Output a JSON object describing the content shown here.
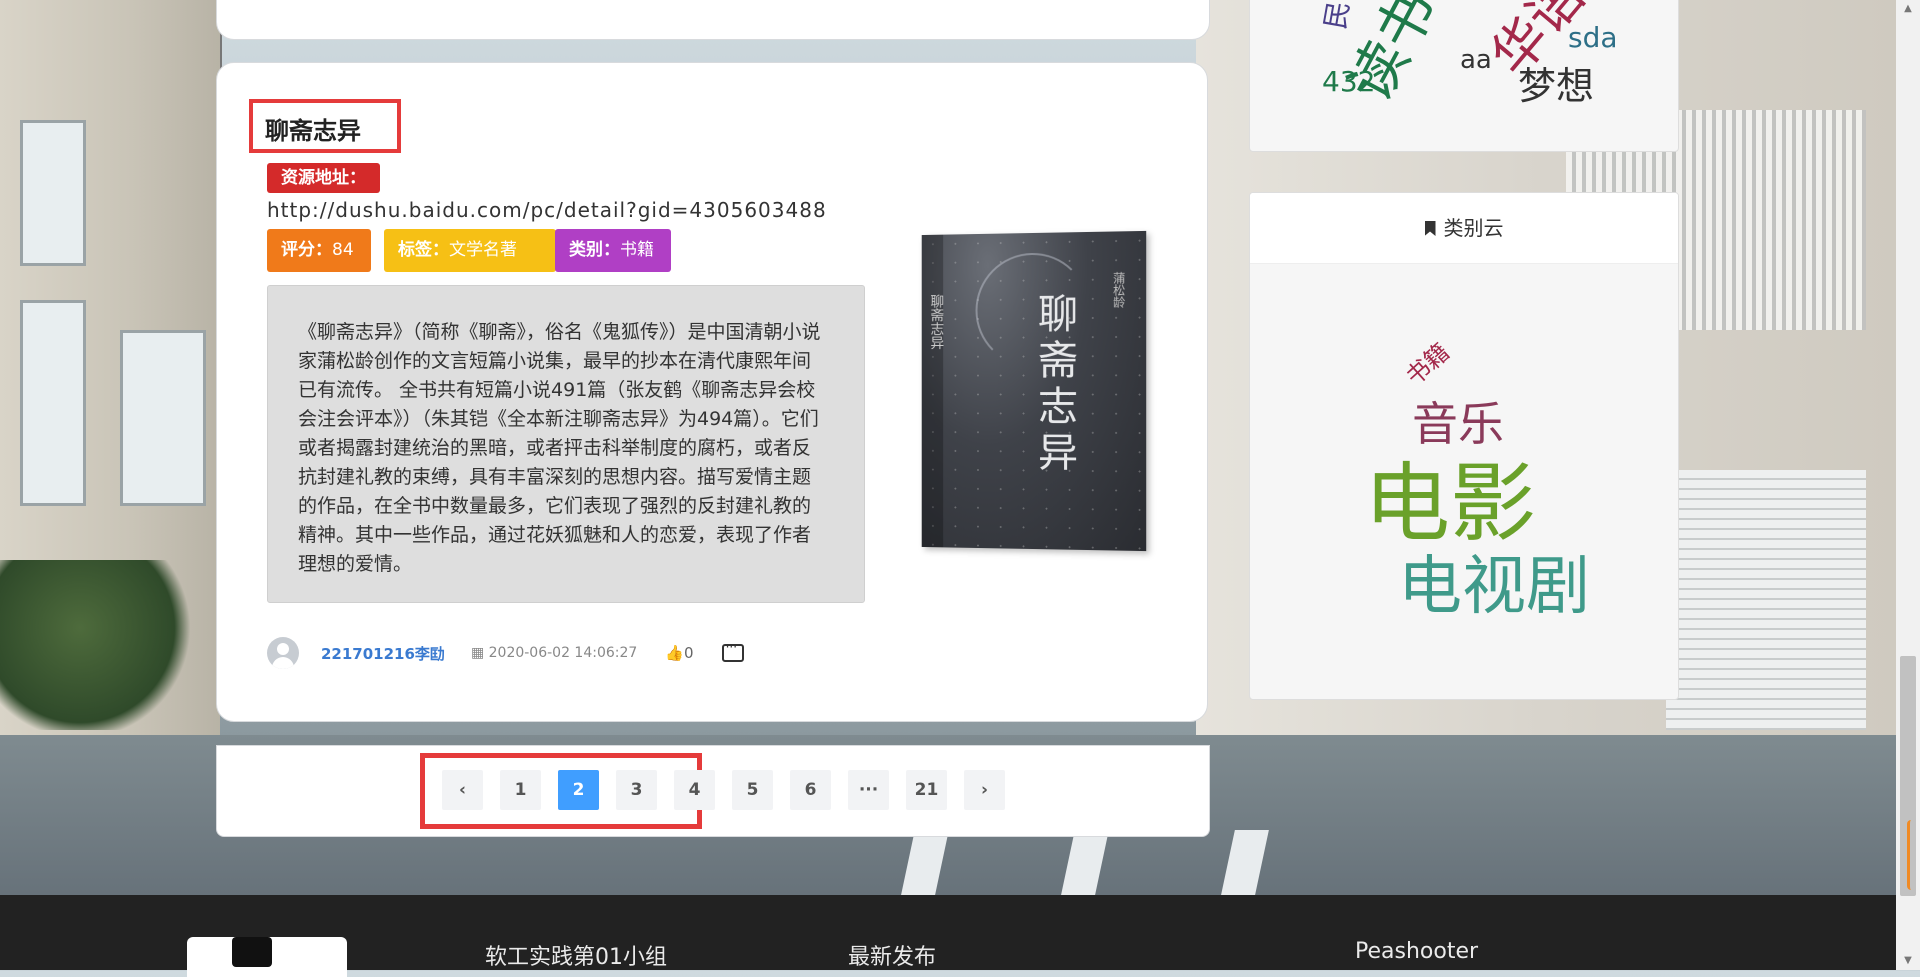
{
  "article": {
    "title": "聊斋志异",
    "resource_label": "资源地址：",
    "url": "http://dushu.baidu.com/pc/detail?gid=4305603488",
    "score_label": "评分：",
    "score_value": "84",
    "tag_label": "标签：",
    "tag_value": "文学名著",
    "category_label": "类别：",
    "category_value": "书籍",
    "description": "《聊斋志异》（简称《聊斋》，俗名《鬼狐传》）是中国清朝小说家蒲松龄创作的文言短篇小说集，最早的抄本在清代康熙年间已有流传。 全书共有短篇小说491篇（张友鹤《聊斋志异会校会注会评本》）（朱其铠《全本新注聊斋志异》为494篇）。它们或者揭露封建统治的黑暗，或者抨击科举制度的腐朽，或者反抗封建礼教的束缚，具有丰富深刻的思想内容。描写爱情主题的作品，在全书中数量最多，它们表现了强烈的反封建礼教的精神。其中一些作品，通过花妖狐魅和人的恋爱，表现了作者理想的爱情。",
    "cover_title": "聊斋志异",
    "cover_author": "蒲松龄",
    "author": "221701216李劻",
    "date": "2020-06-02 14:06:27",
    "likes": "0"
  },
  "pagination": {
    "prev": "‹",
    "next": "›",
    "pages": [
      "1",
      "2",
      "3",
      "4",
      "5",
      "6",
      "···",
      "21"
    ],
    "active": "2"
  },
  "sidebar": {
    "tag_cloud_words": [
      {
        "text": "读书",
        "color": "#1f7a4a"
      },
      {
        "text": "华语",
        "color": "#a3284a"
      },
      {
        "text": "sda",
        "color": "#2d6f87"
      },
      {
        "text": "aa",
        "color": "#333333"
      },
      {
        "text": "432",
        "color": "#1f7a4a"
      },
      {
        "text": "梦想",
        "color": "#333333"
      },
      {
        "text": "民谣",
        "color": "#4a3f8a"
      }
    ],
    "category_cloud_title": "类别云",
    "category_words": [
      {
        "text": "书籍",
        "color": "#a3284a"
      },
      {
        "text": "音乐",
        "color": "#8a3a5a"
      },
      {
        "text": "电影",
        "color": "#6aa12a"
      },
      {
        "text": "电视剧",
        "color": "#3f9a8a"
      }
    ]
  },
  "footer": {
    "team": "软工实践第01小组",
    "latest": "最新发布",
    "brand": "Peashooter"
  }
}
